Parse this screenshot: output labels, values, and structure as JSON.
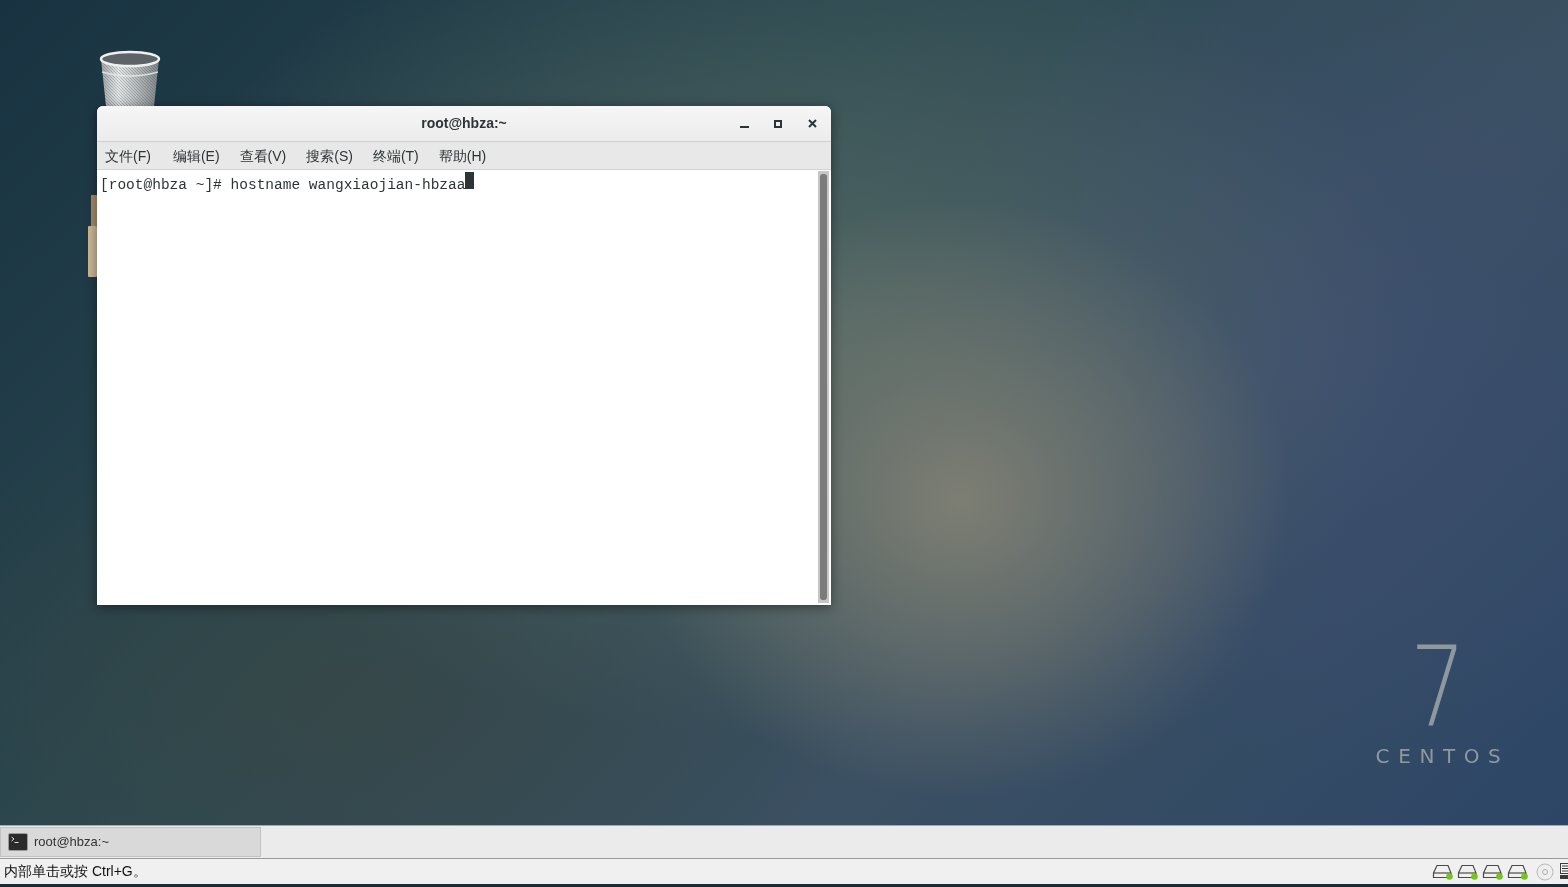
{
  "window": {
    "title": "root@hbza:~",
    "menu": [
      "文件(F)",
      "编辑(E)",
      "查看(V)",
      "搜索(S)",
      "终端(T)",
      "帮助(H)"
    ],
    "terminal": {
      "lines": [
        "[root@hbza ~]# hostname wangxiaojian-hbzaa"
      ]
    }
  },
  "logo": {
    "numeral": "7",
    "wordmark": "CENTOS"
  },
  "taskbar": {
    "tasks": [
      {
        "label": "root@hbza:~"
      }
    ]
  },
  "status_bar": {
    "hint": "内部单击或按 Ctrl+G。"
  }
}
